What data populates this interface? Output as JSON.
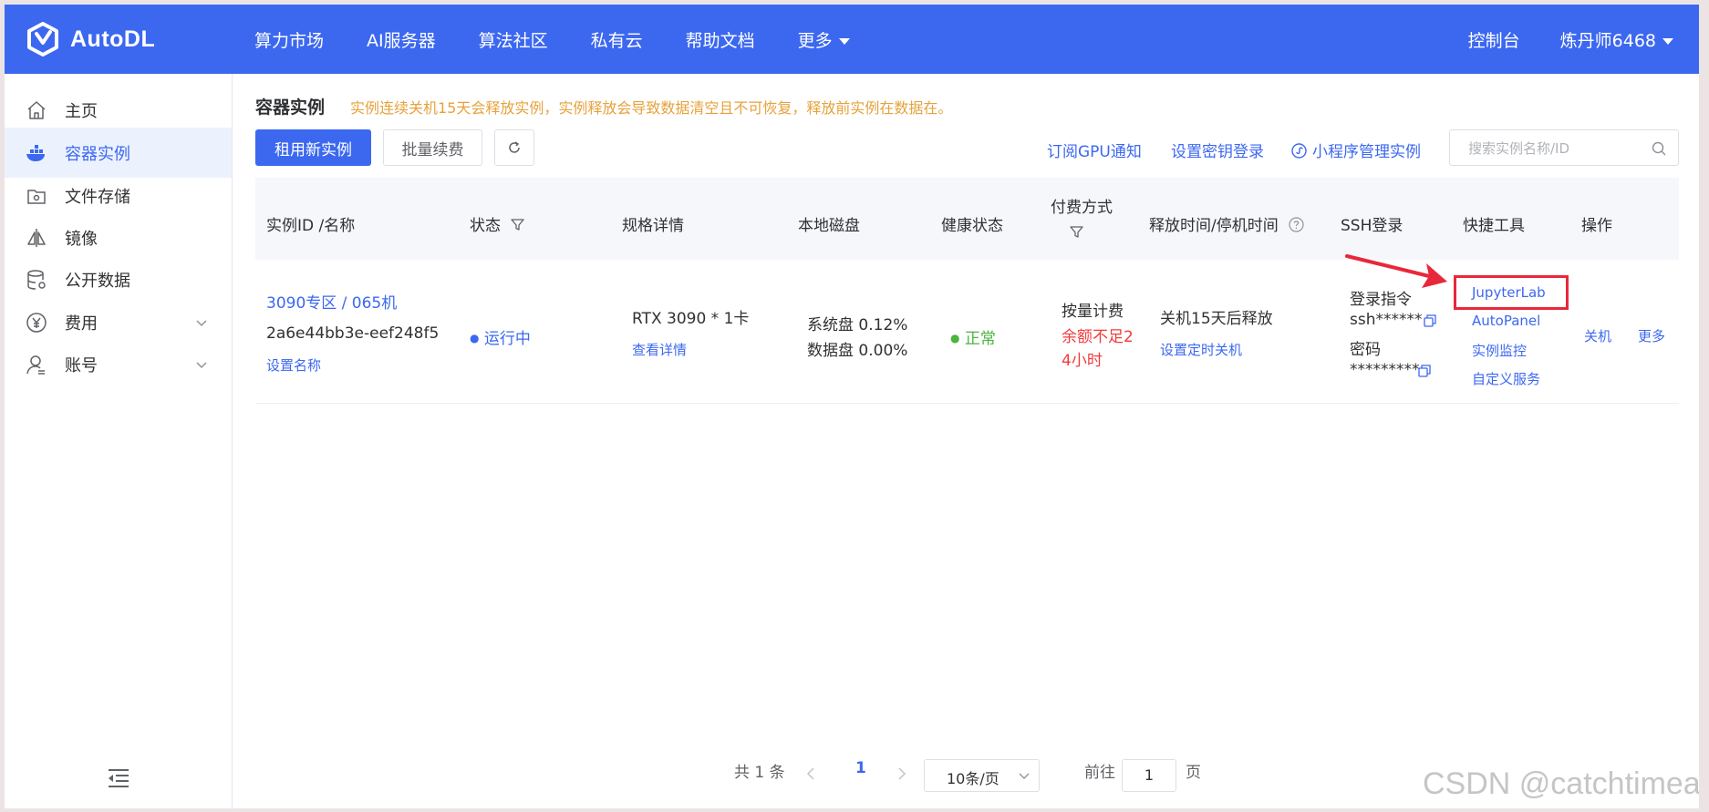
{
  "brand": {
    "name": "AutoDL"
  },
  "nav": {
    "items": [
      "算力市场",
      "AI服务器",
      "算法社区",
      "私有云",
      "帮助文档"
    ],
    "more": "更多"
  },
  "top_right": {
    "console": "控制台",
    "user": "炼丹师6468"
  },
  "sidebar": {
    "items": [
      {
        "label": "主页",
        "icon": "home-icon"
      },
      {
        "label": "容器实例",
        "icon": "container-icon"
      },
      {
        "label": "文件存储",
        "icon": "file-storage-icon"
      },
      {
        "label": "镜像",
        "icon": "mirror-icon"
      },
      {
        "label": "公开数据",
        "icon": "database-icon"
      },
      {
        "label": "费用",
        "icon": "yen-icon"
      },
      {
        "label": "账号",
        "icon": "user-icon"
      }
    ],
    "active_index": 1
  },
  "page": {
    "title": "容器实例",
    "warning": "实例连续关机15天会释放实例，实例释放会导致数据清空且不可恢复，释放前实例在数据在。"
  },
  "toolbar": {
    "rent_label": "租用新实例",
    "renew_label": "批量续费",
    "subscribe_label": "订阅GPU通知",
    "key_label": "设置密钥登录",
    "miniapp_label": "小程序管理实例",
    "search_placeholder": "搜索实例名称/ID"
  },
  "table": {
    "columns": [
      "实例ID /名称",
      "状态",
      "规格详情",
      "本地磁盘",
      "健康状态",
      "付费方式",
      "释放时间/停机时间",
      "SSH登录",
      "快捷工具",
      "操作"
    ],
    "rows": [
      {
        "name": "3090专区 / 065机",
        "id": "2a6e44bb3e-eef248f5",
        "set_name": "设置名称",
        "status": "运行中",
        "spec": "RTX 3090 * 1卡",
        "spec_detail": "查看详情",
        "disk_system": "系统盘 0.12%",
        "disk_data": "数据盘 0.00%",
        "health": "正常",
        "billing": "按量计费",
        "billing_warn_1": "余额不足2",
        "billing_warn_2": "4小时",
        "release": "关机15天后释放",
        "set_shutdown": "设置定时关机",
        "ssh_cmd_label": "登录指令",
        "ssh_cmd": "ssh******",
        "pwd_label": "密码",
        "pwd": "*********",
        "tools": [
          "JupyterLab",
          "AutoPanel",
          "实例监控",
          "自定义服务"
        ],
        "action_shutdown": "关机",
        "action_more": "更多"
      }
    ]
  },
  "pagination": {
    "total": "共 1 条",
    "current_page": "1",
    "page_size": "10条/页",
    "goto_label": "前往",
    "goto_value": "1",
    "page_suffix": "页"
  },
  "watermark": "CSDN @catchtimea",
  "colors": {
    "brand": "#3c68f0",
    "warning": "#e6a23c",
    "danger": "#f23c3c",
    "success": "#49b53b",
    "highlight": "#e8283a"
  }
}
